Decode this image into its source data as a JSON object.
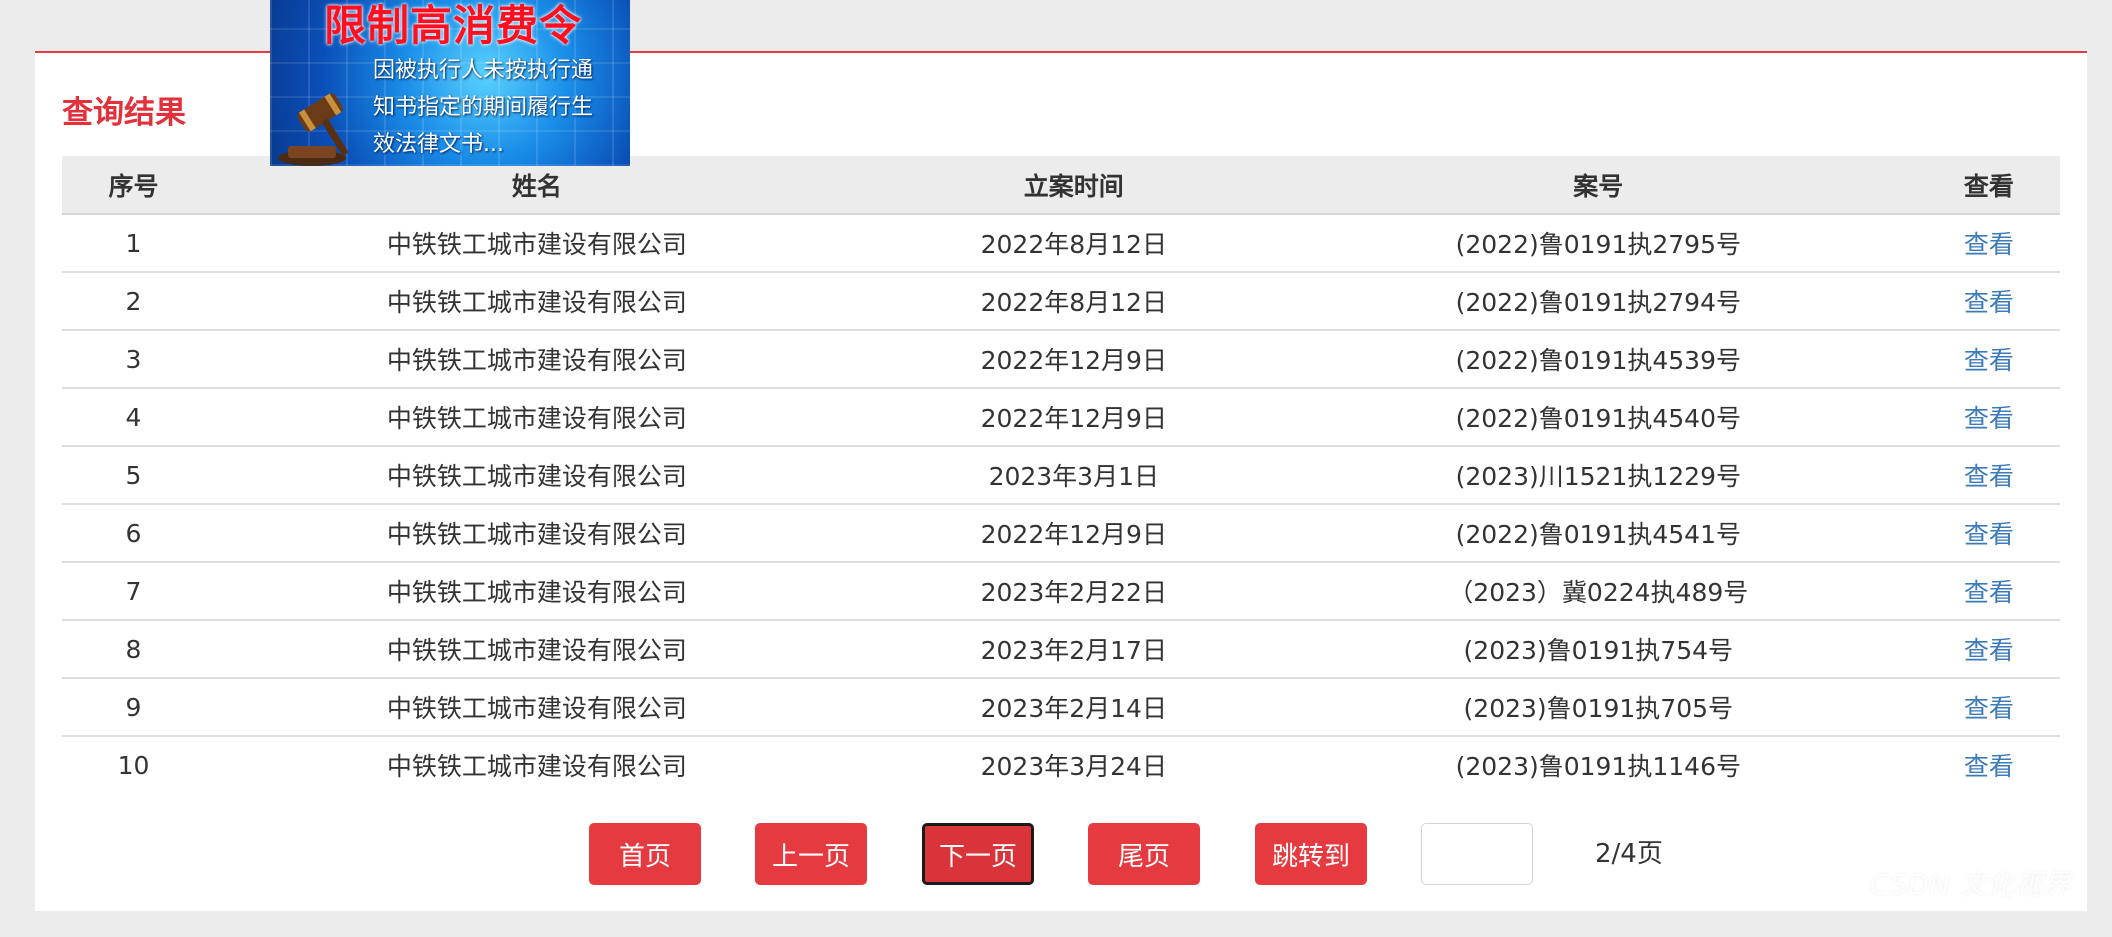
{
  "banner": {
    "title": "限制高消费令",
    "text": "因被执行人未按执行通知书指定的期间履行生效法律文书..."
  },
  "section_title": "查询结果",
  "table": {
    "headers": [
      "序号",
      "姓名",
      "立案时间",
      "案号",
      "查看"
    ],
    "rows": [
      {
        "index": "1",
        "name": "中铁铁工城市建设有限公司",
        "date": "2022年8月12日",
        "case_no": "(2022)鲁0191执2795号",
        "view": "查看"
      },
      {
        "index": "2",
        "name": "中铁铁工城市建设有限公司",
        "date": "2022年8月12日",
        "case_no": "(2022)鲁0191执2794号",
        "view": "查看"
      },
      {
        "index": "3",
        "name": "中铁铁工城市建设有限公司",
        "date": "2022年12月9日",
        "case_no": "(2022)鲁0191执4539号",
        "view": "查看"
      },
      {
        "index": "4",
        "name": "中铁铁工城市建设有限公司",
        "date": "2022年12月9日",
        "case_no": "(2022)鲁0191执4540号",
        "view": "查看"
      },
      {
        "index": "5",
        "name": "中铁铁工城市建设有限公司",
        "date": "2023年3月1日",
        "case_no": "(2023)川1521执1229号",
        "view": "查看"
      },
      {
        "index": "6",
        "name": "中铁铁工城市建设有限公司",
        "date": "2022年12月9日",
        "case_no": "(2022)鲁0191执4541号",
        "view": "查看"
      },
      {
        "index": "7",
        "name": "中铁铁工城市建设有限公司",
        "date": "2023年2月22日",
        "case_no": "（2023）冀0224执489号",
        "view": "查看"
      },
      {
        "index": "8",
        "name": "中铁铁工城市建设有限公司",
        "date": "2023年2月17日",
        "case_no": "(2023)鲁0191执754号",
        "view": "查看"
      },
      {
        "index": "9",
        "name": "中铁铁工城市建设有限公司",
        "date": "2023年2月14日",
        "case_no": "(2023)鲁0191执705号",
        "view": "查看"
      },
      {
        "index": "10",
        "name": "中铁铁工城市建设有限公司",
        "date": "2023年3月24日",
        "case_no": "(2023)鲁0191执1146号",
        "view": "查看"
      }
    ]
  },
  "pagination": {
    "first": "首页",
    "prev": "上一页",
    "next": "下一页",
    "last": "尾页",
    "jump": "跳转到",
    "jump_input_value": "",
    "page_info": "2/4页",
    "active": "next"
  },
  "watermark": "CSDN 文化视界",
  "colors": {
    "accent": "#e53a40",
    "title_red": "#e2313a",
    "link_blue": "#3d7ab8",
    "header_bg": "#ececec"
  }
}
